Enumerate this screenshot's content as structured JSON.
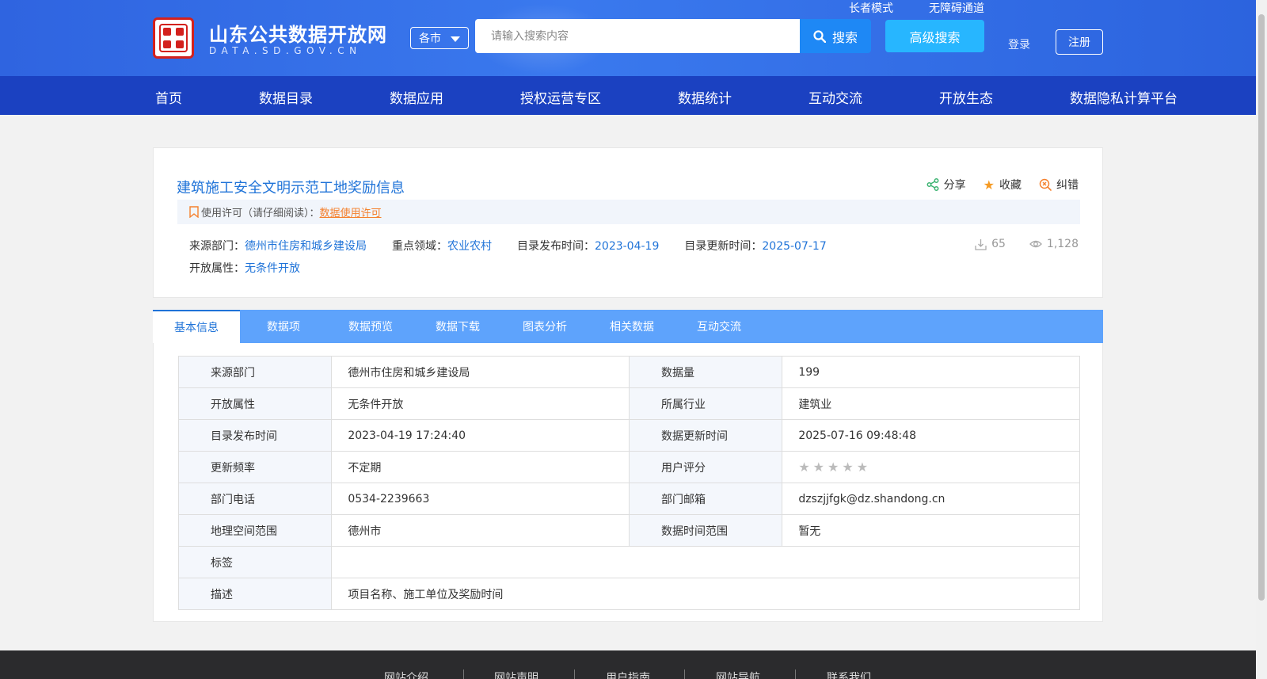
{
  "header": {
    "site_title": "山东公共数据开放网",
    "site_subtitle": "DATA.SD.GOV.CN",
    "region_select": "各市",
    "search": {
      "placeholder": "请输入搜索内容",
      "button_label": "搜索"
    },
    "advanced_search": "高级搜索",
    "elder_mode": "长者模式",
    "accessibility": "无障碍通道",
    "login": "登录",
    "register": "注册",
    "colors": {
      "header_bg": "#2f64e0",
      "nav_bg": "#1b41c1",
      "accent": "#1e88f5"
    }
  },
  "nav": {
    "items": [
      {
        "label": "首页"
      },
      {
        "label": "数据目录"
      },
      {
        "label": "数据应用"
      },
      {
        "label": "授权运营专区"
      },
      {
        "label": "数据统计"
      },
      {
        "label": "互动交流"
      },
      {
        "label": "开放生态"
      },
      {
        "label": "数据隐私计算平台"
      }
    ]
  },
  "dataset": {
    "title": "建筑施工安全文明示范工地奖励信息",
    "actions": {
      "share": "分享",
      "favorite": "收藏",
      "report": "纠错"
    },
    "license": {
      "label": "使用许可（请仔细阅读）：",
      "link": "数据使用许可"
    },
    "meta": {
      "source_label": "来源部门：",
      "source_value": "德州市住房和城乡建设局",
      "domain_label": "重点领域：",
      "domain_value": "农业农村",
      "publish_label": "目录发布时间：",
      "publish_value": "2023-04-19",
      "update_label": "目录更新时间：",
      "update_value": "2025-07-17",
      "open_label": "开放属性：",
      "open_value": "无条件开放"
    },
    "stats": {
      "downloads": "65",
      "views": "1,128"
    }
  },
  "tabs": [
    {
      "label": "基本信息",
      "active": true
    },
    {
      "label": "数据项"
    },
    {
      "label": "数据预览"
    },
    {
      "label": "数据下载"
    },
    {
      "label": "图表分析"
    },
    {
      "label": "相关数据"
    },
    {
      "label": "互动交流"
    }
  ],
  "info_table": {
    "rows": [
      {
        "l1": "来源部门",
        "v1": "德州市住房和城乡建设局",
        "l2": "数据量",
        "v2": "199"
      },
      {
        "l1": "开放属性",
        "v1": "无条件开放",
        "l2": "所属行业",
        "v2": "建筑业"
      },
      {
        "l1": "目录发布时间",
        "v1": "2023-04-19 17:24:40",
        "l2": "数据更新时间",
        "v2": "2025-07-16 09:48:48"
      },
      {
        "l1": "更新频率",
        "v1": "不定期",
        "l2": "用户评分",
        "rating": 0,
        "rating_max": 5
      },
      {
        "l1": "部门电话",
        "v1": "0534-2239663",
        "l2": "部门邮箱",
        "v2": "dzszjjfgk@dz.shandong.cn"
      },
      {
        "l1": "地理空间范围",
        "v1": "德州市",
        "l2": "数据时间范围",
        "v2": "暂无"
      }
    ],
    "tags_label": "标签",
    "tags_value": "",
    "desc_label": "描述",
    "desc_value": "项目名称、施工单位及奖励时间"
  },
  "footer": {
    "links": [
      {
        "label": "网站介绍"
      },
      {
        "label": "网站声明"
      },
      {
        "label": "用户指南"
      },
      {
        "label": "网站导航"
      },
      {
        "label": "联系我们"
      }
    ]
  }
}
